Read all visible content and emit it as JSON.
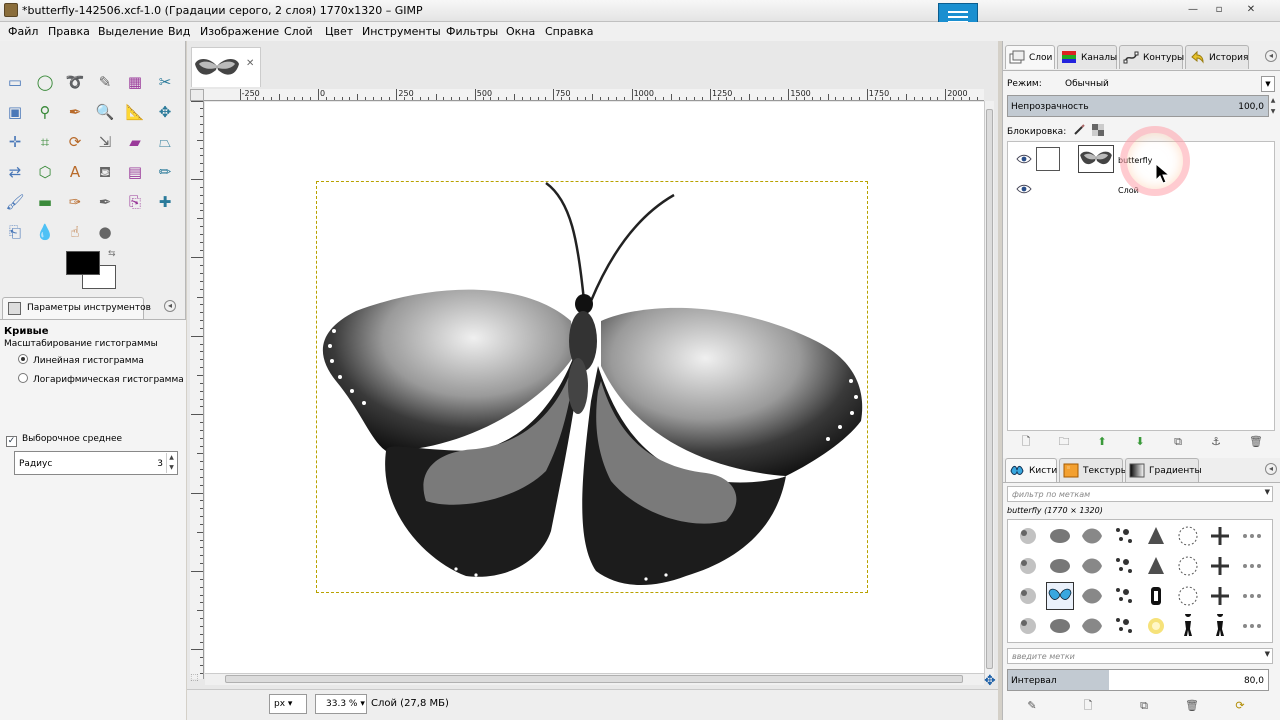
{
  "window": {
    "title": "*butterfly-142506.xcf-1.0 (Градации серого, 2 слоя) 1770x1320 – GIMP",
    "minimize": "—",
    "maximize": "▫",
    "close": "✕"
  },
  "menu": [
    {
      "label": "Файл"
    },
    {
      "label": "Правка"
    },
    {
      "label": "Выделение"
    },
    {
      "label": "Вид"
    },
    {
      "label": "Изображение"
    },
    {
      "label": "Слой"
    },
    {
      "label": "Цвет"
    },
    {
      "label": "Инструменты"
    },
    {
      "label": "Фильтры"
    },
    {
      "label": "Окна"
    },
    {
      "label": "Справка"
    }
  ],
  "toolbox": {
    "tools": [
      {
        "name": "rect-select-icon",
        "glyph": "▭"
      },
      {
        "name": "ellipse-select-icon",
        "glyph": "◯"
      },
      {
        "name": "free-select-icon",
        "glyph": "➰"
      },
      {
        "name": "fuzzy-select-icon",
        "glyph": "✎"
      },
      {
        "name": "select-by-color-icon",
        "glyph": "▦"
      },
      {
        "name": "scissors-icon",
        "glyph": "✂"
      },
      {
        "name": "foreground-select-icon",
        "glyph": "▣"
      },
      {
        "name": "paths-icon",
        "glyph": "⚲"
      },
      {
        "name": "color-picker-icon",
        "glyph": "✒"
      },
      {
        "name": "zoom-icon",
        "glyph": "🔍"
      },
      {
        "name": "measure-icon",
        "glyph": "📐"
      },
      {
        "name": "move-icon",
        "glyph": "✥"
      },
      {
        "name": "align-icon",
        "glyph": "✛"
      },
      {
        "name": "crop-icon",
        "glyph": "⌗"
      },
      {
        "name": "rotate-icon",
        "glyph": "⟳"
      },
      {
        "name": "scale-icon",
        "glyph": "⇲"
      },
      {
        "name": "shear-icon",
        "glyph": "▰"
      },
      {
        "name": "perspective-icon",
        "glyph": "⏢"
      },
      {
        "name": "flip-icon",
        "glyph": "⇄"
      },
      {
        "name": "cage-icon",
        "glyph": "⬡"
      },
      {
        "name": "text-icon",
        "glyph": "A"
      },
      {
        "name": "bucket-fill-icon",
        "glyph": "⛾"
      },
      {
        "name": "blend-icon",
        "glyph": "▤"
      },
      {
        "name": "pencil-icon",
        "glyph": "✏"
      },
      {
        "name": "paintbrush-icon",
        "glyph": "🖌"
      },
      {
        "name": "eraser-icon",
        "glyph": "▬"
      },
      {
        "name": "airbrush-icon",
        "glyph": "✑"
      },
      {
        "name": "ink-icon",
        "glyph": "✒"
      },
      {
        "name": "clone-icon",
        "glyph": "⎘"
      },
      {
        "name": "heal-icon",
        "glyph": "✚"
      },
      {
        "name": "perspective-clone-icon",
        "glyph": "⎗"
      },
      {
        "name": "blur-icon",
        "glyph": "💧"
      },
      {
        "name": "smudge-icon",
        "glyph": "☝"
      },
      {
        "name": "dodge-burn-icon",
        "glyph": "●"
      }
    ]
  },
  "tool_options": {
    "tab_label": "Параметры инструментов",
    "title": "Кривые",
    "subtitle": "Масштабирование гистограммы",
    "radio_linear": "Линейная гистограмма",
    "radio_log": "Логарифмическая гистограмма",
    "sample_average": "Выборочное среднее",
    "radius_label": "Радиус",
    "radius_value": "3"
  },
  "canvas": {
    "ruler_labels": [
      "-250",
      "0",
      "250",
      "500",
      "750",
      "1000",
      "1250",
      "1500",
      "1750",
      "2000"
    ],
    "unit": "px",
    "zoom": "33.3 %",
    "status": "Слой (27,8 МБ)"
  },
  "layers_dock": {
    "tabs": [
      {
        "label": "Слои"
      },
      {
        "label": "Каналы"
      },
      {
        "label": "Контуры"
      },
      {
        "label": "История"
      }
    ],
    "mode_label": "Режим:",
    "mode_value": "Обычный",
    "opacity_label": "Непрозрачность",
    "opacity_value": "100,0",
    "opacity_fraction": 1.0,
    "lock_label": "Блокировка:",
    "layers": [
      {
        "name": "butterfly"
      },
      {
        "name": "Слой"
      }
    ]
  },
  "brushes_dock": {
    "tabs": [
      {
        "label": "Кисти"
      },
      {
        "label": "Текстуры"
      },
      {
        "label": "Градиенты"
      }
    ],
    "filter_placeholder": "фильтр по меткам",
    "brush_name": "butterfly (1770 × 1320)",
    "tags_placeholder": "введите метки",
    "spacing_label": "Интервал",
    "spacing_value": "80,0",
    "spacing_fraction": 0.8
  }
}
